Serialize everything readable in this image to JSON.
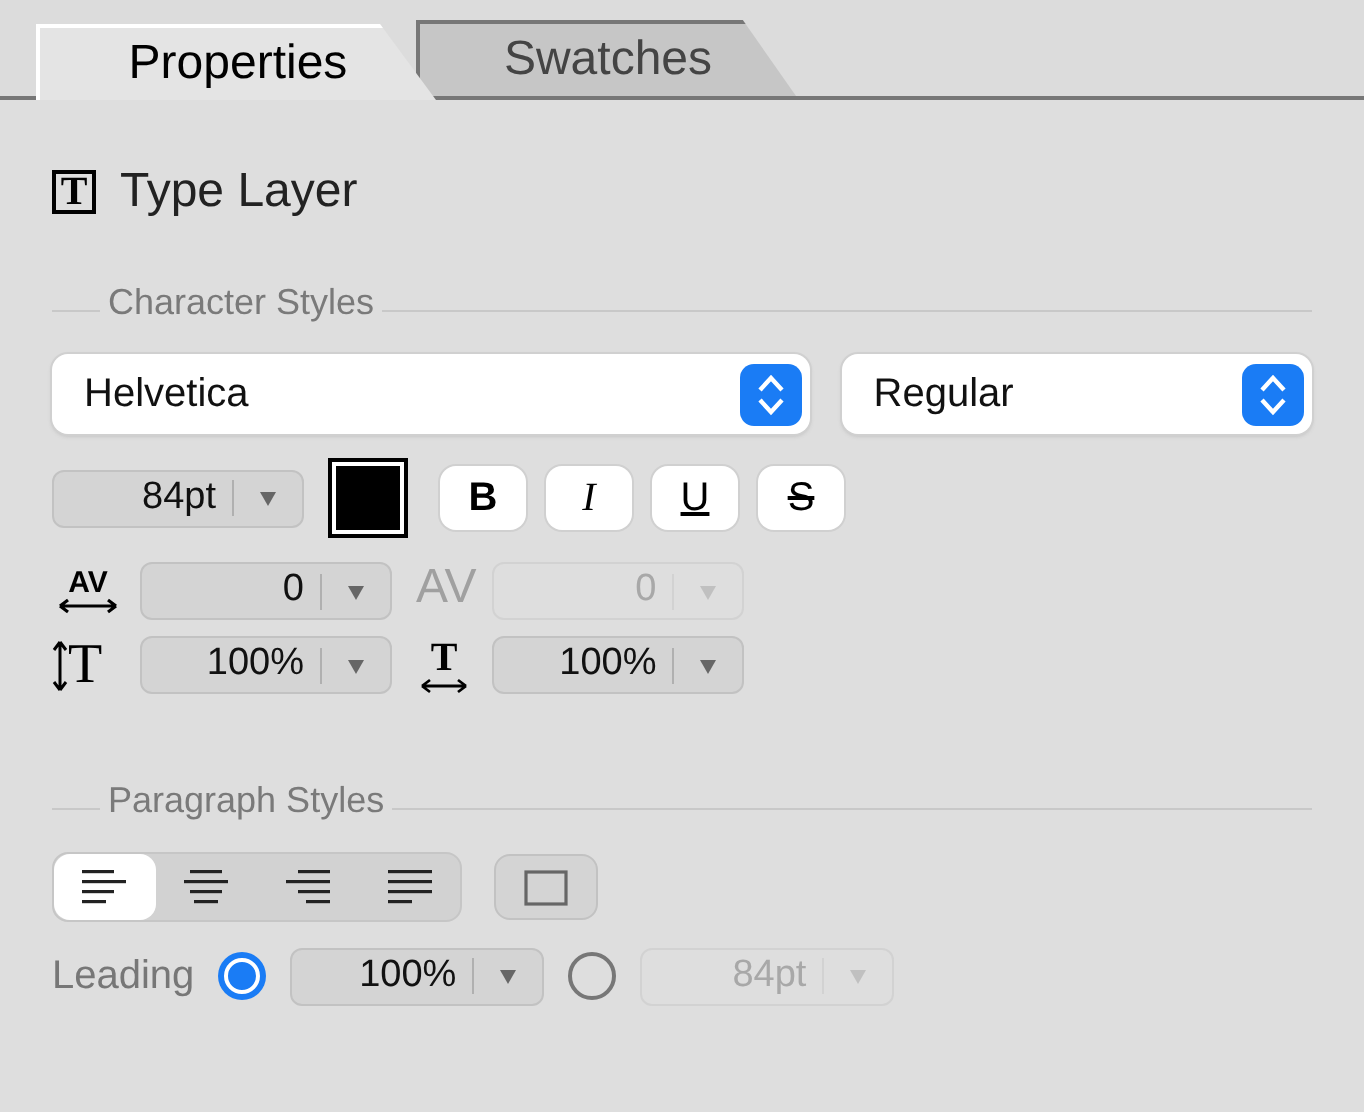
{
  "tabs": [
    {
      "label": "Properties",
      "selected": true
    },
    {
      "label": "Swatches",
      "selected": false
    }
  ],
  "layer": {
    "icon_glyph": "T",
    "title": "Type Layer"
  },
  "character": {
    "heading": "Character Styles",
    "font_family": "Helvetica",
    "font_style": "Regular",
    "size": {
      "value": "84pt",
      "disabled": false
    },
    "color": "#000000",
    "styles": [
      {
        "label": "B",
        "kind": "bold",
        "selected": false
      },
      {
        "label": "I",
        "kind": "italic",
        "selected": false
      },
      {
        "label": "U",
        "kind": "underline",
        "selected": false
      },
      {
        "label": "S",
        "kind": "strike",
        "selected": false
      }
    ],
    "spacing": [
      {
        "glyph": "AV",
        "kind": "tracking",
        "value": "0",
        "disabled": false
      },
      {
        "glyph": "AV",
        "kind": "kerning",
        "value": "0",
        "disabled": true
      },
      {
        "glyph": "T",
        "kind": "vscale",
        "value": "100%",
        "disabled": false
      },
      {
        "glyph": "T",
        "kind": "hscale",
        "value": "100%",
        "disabled": false
      }
    ]
  },
  "paragraph": {
    "heading": "Paragraph Styles",
    "alignments": [
      {
        "kind": "left",
        "selected": true
      },
      {
        "kind": "center",
        "selected": false
      },
      {
        "kind": "right",
        "selected": false
      },
      {
        "kind": "justify",
        "selected": false
      }
    ],
    "leading_label": "Leading",
    "leading": [
      {
        "value": "100%",
        "selected": true
      },
      {
        "value": "84pt",
        "selected": false
      }
    ]
  }
}
